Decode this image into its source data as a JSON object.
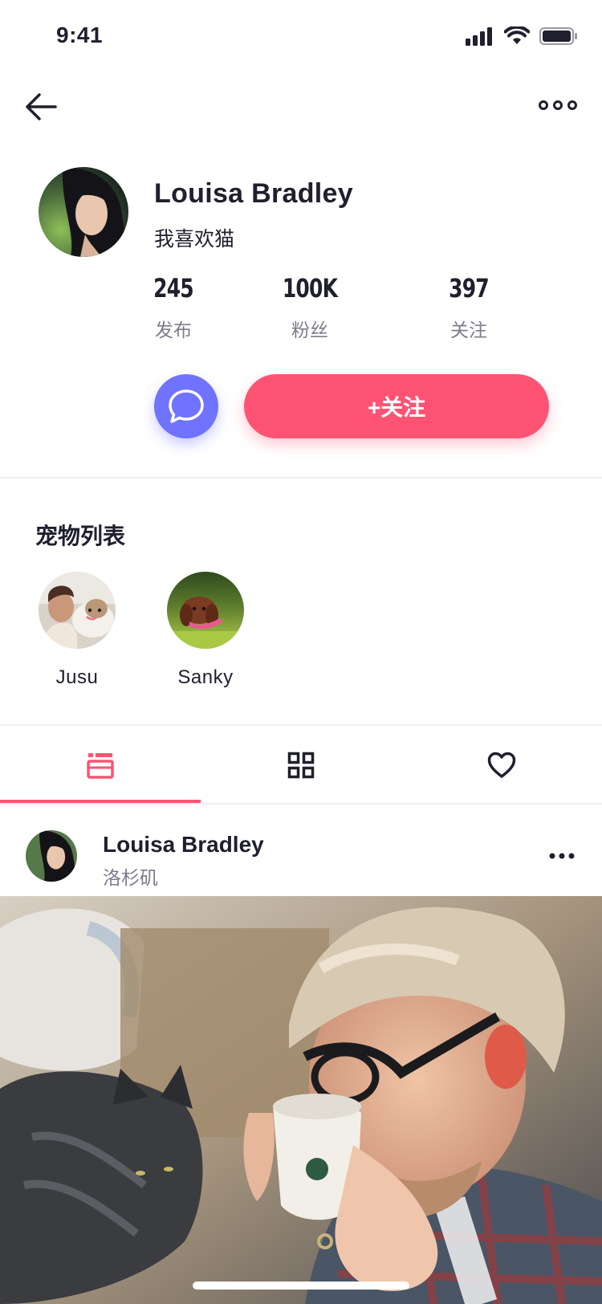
{
  "status_bar": {
    "time": "9:41"
  },
  "profile": {
    "name": "Louisa Bradley",
    "bio": "我喜欢猫",
    "stats": [
      {
        "value": "245",
        "label": "发布"
      },
      {
        "value": "100K",
        "label": "粉丝"
      },
      {
        "value": "397",
        "label": "关注"
      }
    ],
    "follow_label": "+关注"
  },
  "pets": {
    "title": "宠物列表",
    "items": [
      {
        "name": "Jusu"
      },
      {
        "name": "Sanky"
      }
    ]
  },
  "tabs": [
    {
      "icon": "feed-card-icon",
      "active": true
    },
    {
      "icon": "grid-icon",
      "active": false
    },
    {
      "icon": "heart-icon",
      "active": false
    }
  ],
  "post": {
    "author": "Louisa Bradley",
    "location": "洛杉矶"
  },
  "colors": {
    "accent": "#ff5374",
    "chat_button": "#6f73ff",
    "text_primary": "#1f1f2e",
    "text_secondary": "#7d7d8c"
  }
}
